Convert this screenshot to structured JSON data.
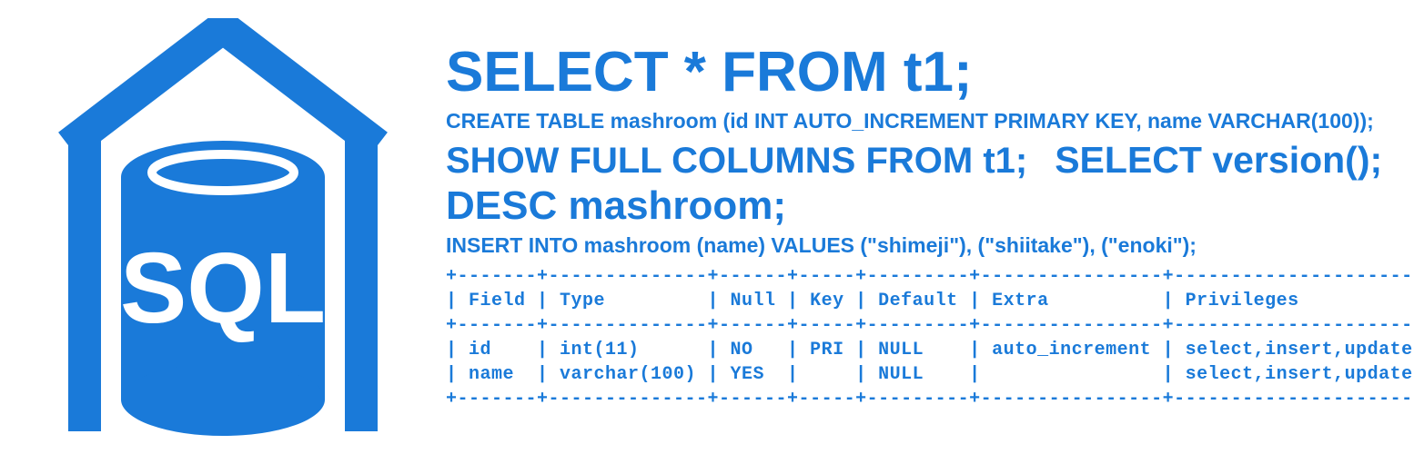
{
  "logo": {
    "text": "SQL"
  },
  "queries": {
    "select_all": "SELECT * FROM t1;",
    "create_table": "CREATE TABLE mashroom (id INT AUTO_INCREMENT PRIMARY KEY, name VARCHAR(100));",
    "show_columns": "SHOW FULL COLUMNS FROM t1;",
    "select_version": "SELECT version();",
    "desc": "DESC mashroom;",
    "insert": "INSERT INTO mashroom (name) VALUES (\"shimeji\"), (\"shiitake\"), (\"enoki\");"
  },
  "table": {
    "border": "+-------+--------------+------+-----+---------+----------------+---------------------------------+",
    "header": "| Field | Type         | Null | Key | Default | Extra          | Privileges                      |",
    "row1": "| id    | int(11)      | NO   | PRI | NULL    | auto_increment | select,insert,update,references |",
    "row2": "| name  | varchar(100) | YES  |     | NULL    |                | select,insert,update,references |"
  },
  "chart_data": {
    "type": "table",
    "columns": [
      "Field",
      "Type",
      "Null",
      "Key",
      "Default",
      "Extra",
      "Privileges"
    ],
    "rows": [
      [
        "id",
        "int(11)",
        "NO",
        "PRI",
        "NULL",
        "auto_increment",
        "select,insert,update,references"
      ],
      [
        "name",
        "varchar(100)",
        "YES",
        "",
        "NULL",
        "",
        "select,insert,update,references"
      ]
    ]
  }
}
